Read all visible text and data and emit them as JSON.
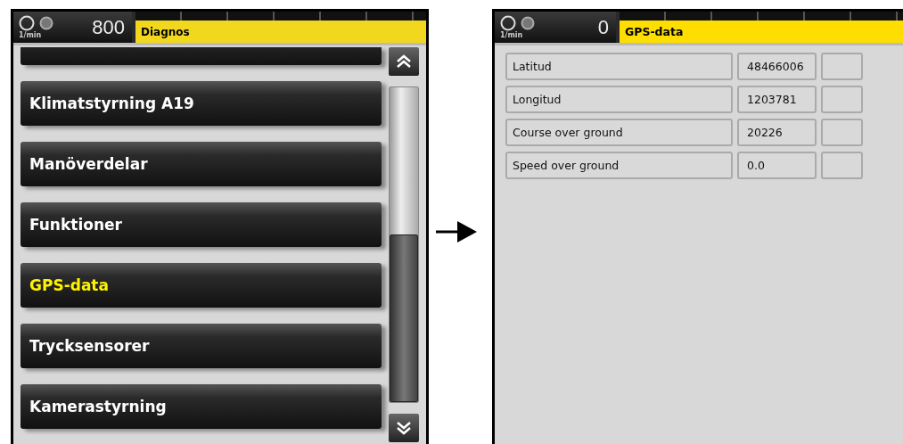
{
  "screens": [
    {
      "kind": "menu",
      "rpm_unit": "1/min",
      "rpm": "800",
      "title": "Diagnos",
      "items": [
        {
          "label": "Klimatstyrning A19",
          "selected": false
        },
        {
          "label": "Manöverdelar",
          "selected": false
        },
        {
          "label": "Funktioner",
          "selected": false
        },
        {
          "label": "GPS-data",
          "selected": true
        },
        {
          "label": "Trycksensorer",
          "selected": false
        },
        {
          "label": "Kamerastyrning",
          "selected": false
        }
      ]
    },
    {
      "kind": "table",
      "rpm_unit": "1/min",
      "rpm": "0",
      "title": "GPS-data",
      "rows": [
        {
          "label": "Latitud",
          "value": "48466006"
        },
        {
          "label": "Longitud",
          "value": "1203781"
        },
        {
          "label": "Course over ground",
          "value": "20226"
        },
        {
          "label": "Speed over ground",
          "value": "0.0"
        }
      ]
    }
  ]
}
